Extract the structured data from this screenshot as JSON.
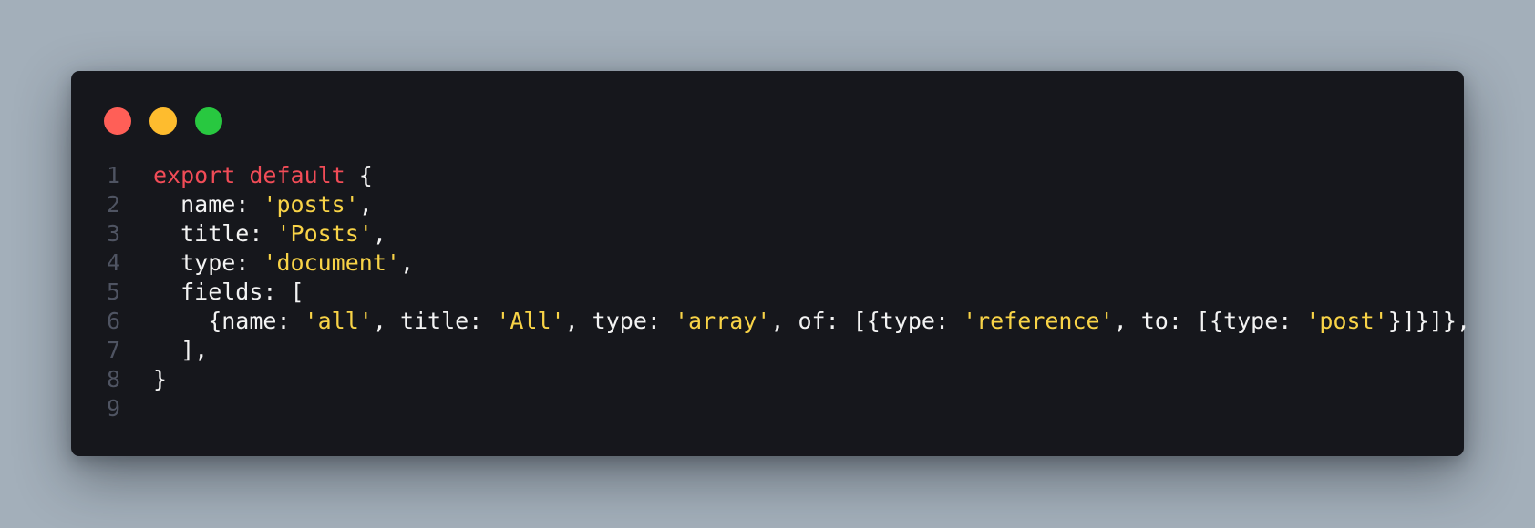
{
  "window": {
    "controls": [
      {
        "name": "close",
        "color": "#ff5f57"
      },
      {
        "name": "minimize",
        "color": "#febc2e"
      },
      {
        "name": "maximize",
        "color": "#28c840"
      }
    ]
  },
  "colors": {
    "keyword": "#f14c57",
    "string": "#f8d347",
    "plain": "#f3f3f3",
    "line_number": "#4f5462",
    "background": "#16171c",
    "page_background": "#a3afba"
  },
  "editor": {
    "language": "javascript",
    "lines": [
      {
        "number": "1",
        "tokens": [
          {
            "text": "export default",
            "kind": "keyword"
          },
          {
            "text": " {",
            "kind": "plain"
          }
        ]
      },
      {
        "number": "2",
        "tokens": [
          {
            "text": "  name: ",
            "kind": "plain"
          },
          {
            "text": "'posts'",
            "kind": "string"
          },
          {
            "text": ",",
            "kind": "plain"
          }
        ]
      },
      {
        "number": "3",
        "tokens": [
          {
            "text": "  title: ",
            "kind": "plain"
          },
          {
            "text": "'Posts'",
            "kind": "string"
          },
          {
            "text": ",",
            "kind": "plain"
          }
        ]
      },
      {
        "number": "4",
        "tokens": [
          {
            "text": "  type: ",
            "kind": "plain"
          },
          {
            "text": "'document'",
            "kind": "string"
          },
          {
            "text": ",",
            "kind": "plain"
          }
        ]
      },
      {
        "number": "5",
        "tokens": [
          {
            "text": "  fields: [",
            "kind": "plain"
          }
        ]
      },
      {
        "number": "6",
        "tokens": [
          {
            "text": "    {name: ",
            "kind": "plain"
          },
          {
            "text": "'all'",
            "kind": "string"
          },
          {
            "text": ", title: ",
            "kind": "plain"
          },
          {
            "text": "'All'",
            "kind": "string"
          },
          {
            "text": ", type: ",
            "kind": "plain"
          },
          {
            "text": "'array'",
            "kind": "string"
          },
          {
            "text": ", of: [{type: ",
            "kind": "plain"
          },
          {
            "text": "'reference'",
            "kind": "string"
          },
          {
            "text": ", to: [{type: ",
            "kind": "plain"
          },
          {
            "text": "'post'",
            "kind": "string"
          },
          {
            "text": "}]}]},",
            "kind": "plain"
          }
        ]
      },
      {
        "number": "7",
        "tokens": [
          {
            "text": "  ],",
            "kind": "plain"
          }
        ]
      },
      {
        "number": "8",
        "tokens": [
          {
            "text": "}",
            "kind": "plain"
          }
        ]
      },
      {
        "number": "9",
        "tokens": []
      }
    ]
  }
}
